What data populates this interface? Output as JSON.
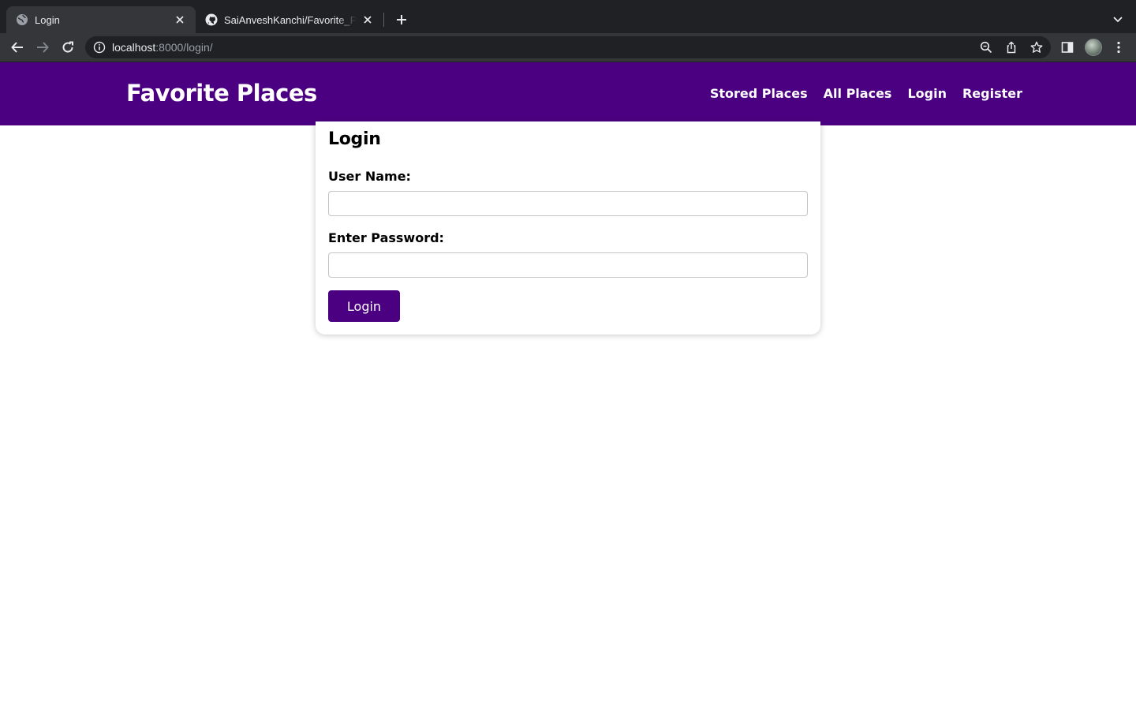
{
  "browser": {
    "tabs": [
      {
        "title": "Login",
        "favicon": "globe-icon",
        "active": true
      },
      {
        "title": "SaiAnveshKanchi/Favorite_Places",
        "favicon": "github-icon",
        "active": false
      }
    ],
    "url_host": "localhost",
    "url_rest": ":8000/login/"
  },
  "header": {
    "brand": "Favorite Places",
    "nav": [
      "Stored Places",
      "All Places",
      "Login",
      "Register"
    ],
    "bg_color": "#4b0082"
  },
  "form": {
    "title": "Login",
    "username_label": "User Name:",
    "username_value": "",
    "password_label": "Enter Password:",
    "password_value": "",
    "submit_label": "Login"
  },
  "colors": {
    "accent": "#4b0082"
  }
}
